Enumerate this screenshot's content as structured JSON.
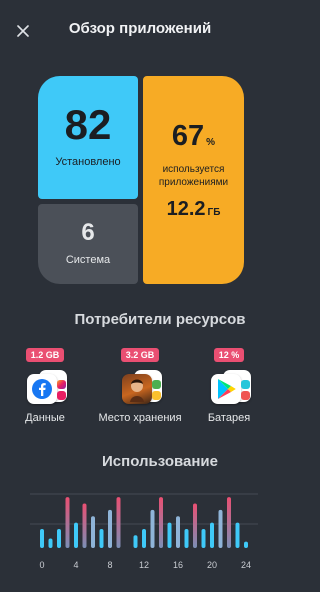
{
  "header": {
    "title": "Обзор приложений",
    "close_icon": "close-icon"
  },
  "tiles": {
    "installed": {
      "value": "82",
      "label": "Установлено",
      "color": "#3fc9f8"
    },
    "system": {
      "value": "6",
      "label": "Система",
      "color": "#4b5058"
    },
    "used_by_apps": {
      "percent": "67",
      "percent_unit": "%",
      "label": "используется приложениями",
      "size": "12.2",
      "size_unit": "ГБ",
      "color": "#f7ab25"
    }
  },
  "consumers": {
    "title": "Потребители ресурсов",
    "badge_color": "#ea4f72",
    "items": [
      {
        "badge": "1.2 GB",
        "label": "Данные",
        "icon": "facebook-icon"
      },
      {
        "badge": "3.2 GB",
        "label": "Место хранения",
        "icon": "game-app-icon"
      },
      {
        "badge": "12 %",
        "label": "Батарея",
        "icon": "google-play-icon"
      }
    ]
  },
  "usage": {
    "title": "Использование",
    "chart_data": {
      "type": "bar",
      "x": [
        0,
        1,
        2,
        3,
        4,
        5,
        6,
        7,
        8,
        9,
        10,
        11,
        12,
        13,
        14,
        15,
        16,
        17,
        18,
        19,
        20,
        21,
        22,
        23,
        24
      ],
      "x_ticks": [
        "0",
        "4",
        "8",
        "12",
        "16",
        "20",
        "24"
      ],
      "series": [
        {
          "values": [
            3,
            1.5,
            3,
            8,
            4,
            7,
            5,
            3,
            6,
            8,
            0,
            2,
            3,
            6,
            8,
            4,
            5,
            3,
            7,
            3,
            4,
            6,
            8,
            4,
            1
          ]
        }
      ],
      "colors": {
        "low": "#3fc9f8",
        "high": "#ea4f72"
      },
      "ylim": [
        0,
        8.5
      ],
      "grid": true
    }
  }
}
